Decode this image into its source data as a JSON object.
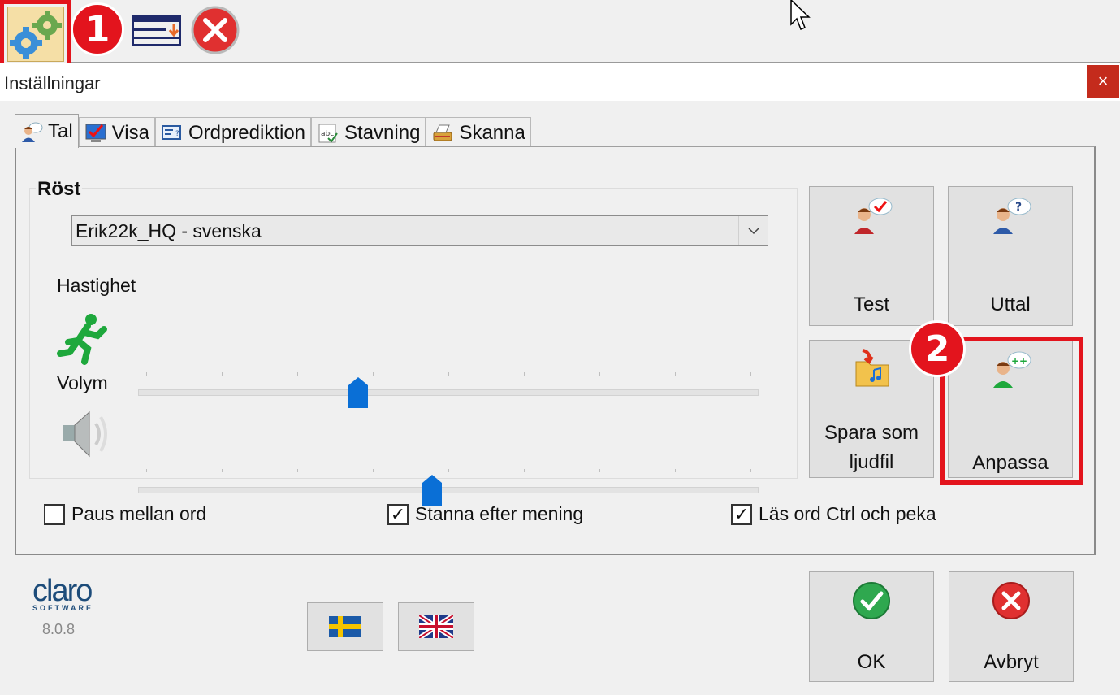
{
  "toolbar": {
    "marker_1": "1",
    "marker_2": "2"
  },
  "dialog": {
    "title": "Inställningar",
    "close_glyph": "×"
  },
  "tabs": [
    {
      "label": "Tal",
      "icon": "speaker-person-icon",
      "active": true
    },
    {
      "label": "Visa",
      "icon": "checkmark-monitor-icon",
      "active": false
    },
    {
      "label": "Ordprediktion",
      "icon": "word-prediction-icon",
      "active": false
    },
    {
      "label": "Stavning",
      "icon": "spelling-abc-icon",
      "active": false
    },
    {
      "label": "Skanna",
      "icon": "scanner-icon",
      "active": false
    }
  ],
  "voice": {
    "group_label": "Röst",
    "selected": "Erik22k_HQ - svenska",
    "speed_label": "Hastighet",
    "speed_value": 0.355,
    "volume_label": "Volym",
    "volume_value": 0.474
  },
  "buttons": {
    "test": "Test",
    "uttal": "Uttal",
    "save_line1": "Spara som",
    "save_line2": "ljudfil",
    "anpassa": "Anpassa",
    "ok": "OK",
    "cancel": "Avbryt"
  },
  "checkboxes": [
    {
      "label": "Paus mellan ord",
      "checked": false
    },
    {
      "label": "Stanna efter mening",
      "checked": true
    },
    {
      "label": "Läs ord Ctrl och peka",
      "checked": true
    }
  ],
  "brand": {
    "name": "claro",
    "sub": "SOFTWARE",
    "version": "8.0.8"
  },
  "colors": {
    "highlight": "#e3141d",
    "slider_thumb": "#0a6fd6",
    "logo": "#1d4c7a"
  }
}
